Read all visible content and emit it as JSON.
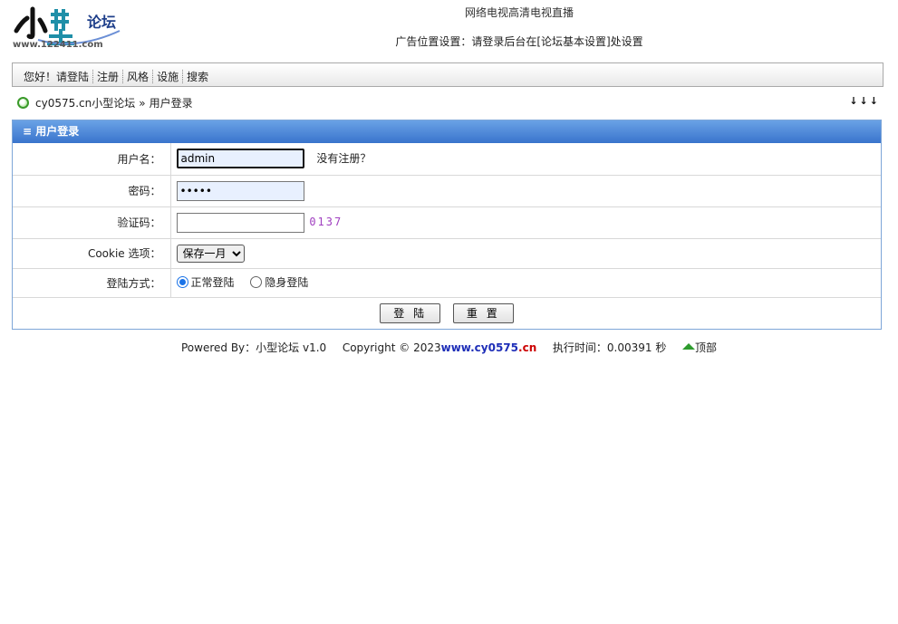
{
  "header": {
    "logo_text": "论坛",
    "logo_url_text": "www.122411.com",
    "top_link": "网络电视高清电视直播",
    "ad_text": "广告位置设置：请登录后台在[论坛基本设置]处设置"
  },
  "nav": {
    "greeting": "您好！",
    "items": [
      "请登陆",
      "注册",
      "风格",
      "设施",
      "搜索"
    ]
  },
  "breadcrumb": {
    "site": "cy0575.cn小型论坛",
    "separator": "»",
    "current": "用户登录",
    "arrows": "↓↓↓"
  },
  "login": {
    "title": "≡ 用户登录",
    "username_label": "用户名：",
    "username_value": "admin",
    "no_account_link": "没有注册？",
    "password_label": "密码：",
    "password_value": "•••••",
    "captcha_label": "验证码：",
    "captcha_value": "",
    "captcha_code": "0137",
    "cookie_label": "Cookie 选项：",
    "cookie_options": [
      "保存一月"
    ],
    "cookie_selected": "保存一月",
    "mode_label": "登陆方式：",
    "mode_normal": "正常登陆",
    "mode_hidden": "隐身登陆",
    "login_button": "登 陆",
    "reset_button": "重 置"
  },
  "footer": {
    "powered_by": "Powered By：小型论坛 v1.0",
    "copyright": "Copyright © 2023",
    "site_main": "www.cy0575",
    "site_tld": ".cn",
    "exec_time": "执行时间：0.00391 秒",
    "top_label": "顶部"
  },
  "colors": {
    "panel_header": "#3974cc",
    "footer_site": "#1f2fb8",
    "footer_tld": "#cc0000",
    "captcha": "#a040c0"
  }
}
